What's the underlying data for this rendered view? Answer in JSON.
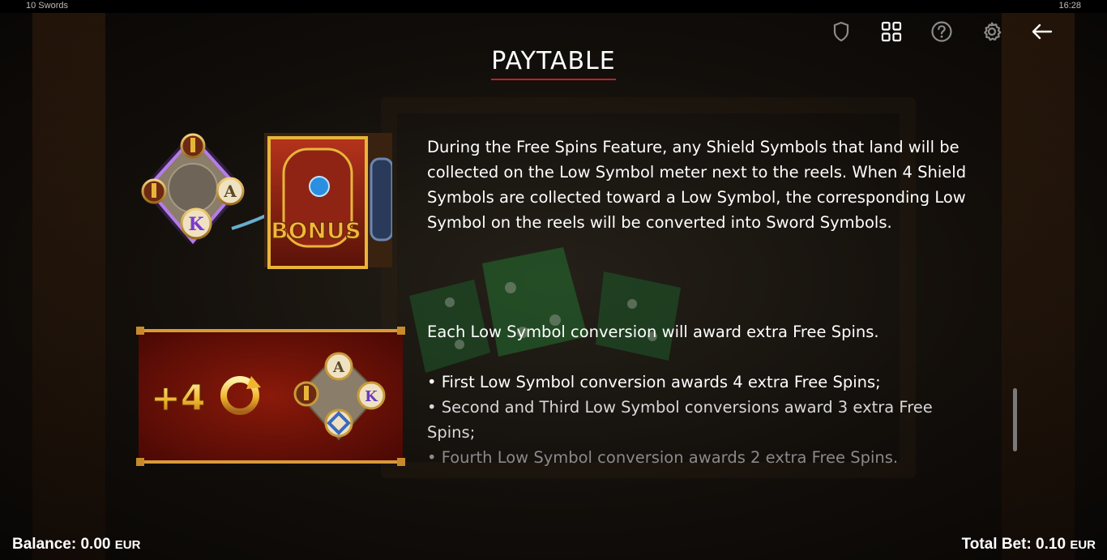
{
  "window": {
    "app_title": "10 Swords",
    "clock": "16:28"
  },
  "toolbar": {
    "icons": [
      "shield-icon",
      "grid-icon",
      "help-icon",
      "settings-icon",
      "back-arrow-icon"
    ]
  },
  "page": {
    "title": "PAYTABLE"
  },
  "feature": {
    "paragraph1": "During the Free Spins Feature, any Shield Symbols that land will be collected on the Low Symbol meter next to the reels. When 4 Shield Symbols are collected toward a Low Symbol, the corresponding Low Symbol on the reels will be converted into Sword Symbols.",
    "paragraph2": "Each Low Symbol conversion will award extra Free Spins.",
    "bullets": [
      "• First Low Symbol conversion awards 4 extra Free Spins;",
      "• Second and Third Low Symbol conversions award 3 extra Free Spins;",
      "• Fourth Low Symbol conversion awards 2 extra Free Spins."
    ]
  },
  "images": {
    "shield_meter": {
      "letters": [
        "A",
        "K"
      ],
      "bonus_label": "BONUS"
    },
    "extra_spins": {
      "label": "+4",
      "letters": [
        "A",
        "K"
      ]
    }
  },
  "footer": {
    "balance_label": "Balance: 0.00",
    "balance_currency": "EUR",
    "bet_label": "Total Bet: 0.10",
    "bet_currency": "EUR"
  },
  "colors": {
    "title_underline": "#c01f2a",
    "gold": "#e8b53a",
    "panel_red": "#7a1208"
  }
}
